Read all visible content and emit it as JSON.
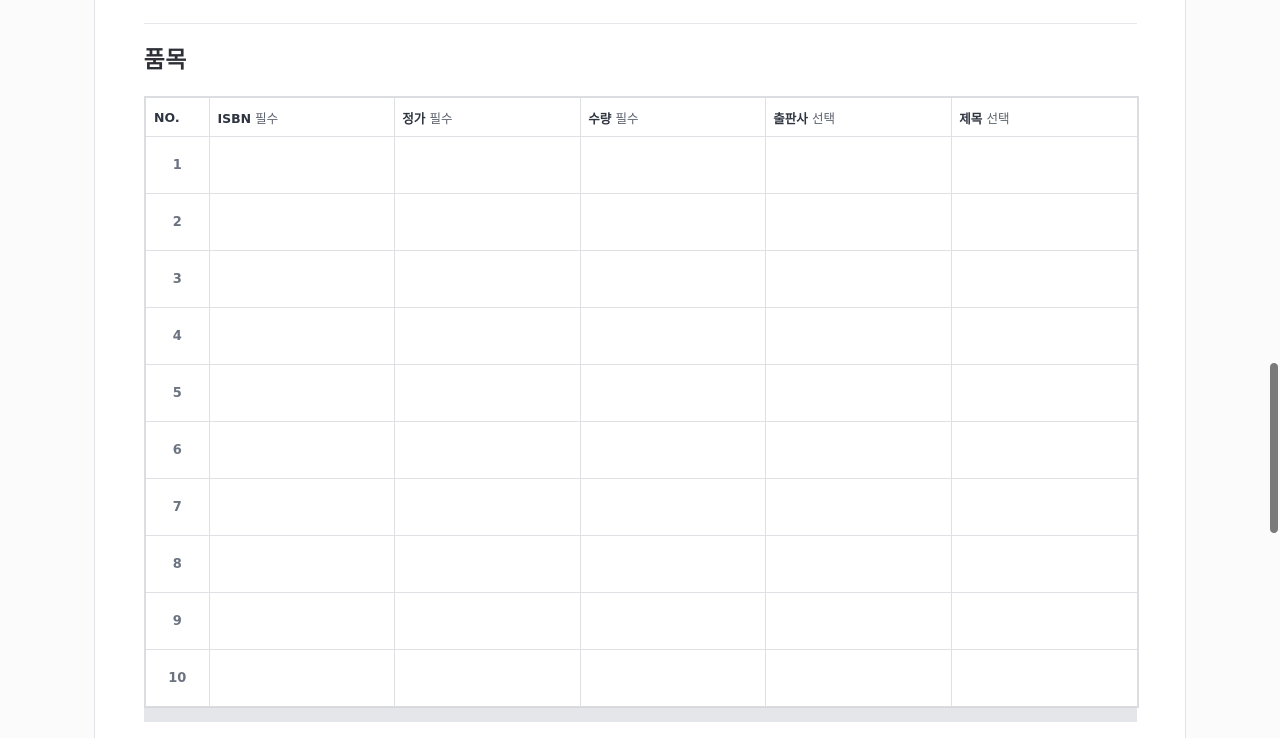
{
  "section": {
    "title": "품목"
  },
  "table": {
    "columns": [
      {
        "label": "NO.",
        "tag": ""
      },
      {
        "label": "ISBN",
        "tag": "필수"
      },
      {
        "label": "정가",
        "tag": "필수"
      },
      {
        "label": "수량",
        "tag": "필수"
      },
      {
        "label": "출판사",
        "tag": "선택"
      },
      {
        "label": "제목",
        "tag": "선택"
      }
    ],
    "rows": [
      "1",
      "2",
      "3",
      "4",
      "5",
      "6",
      "7",
      "8",
      "9",
      "10"
    ]
  }
}
